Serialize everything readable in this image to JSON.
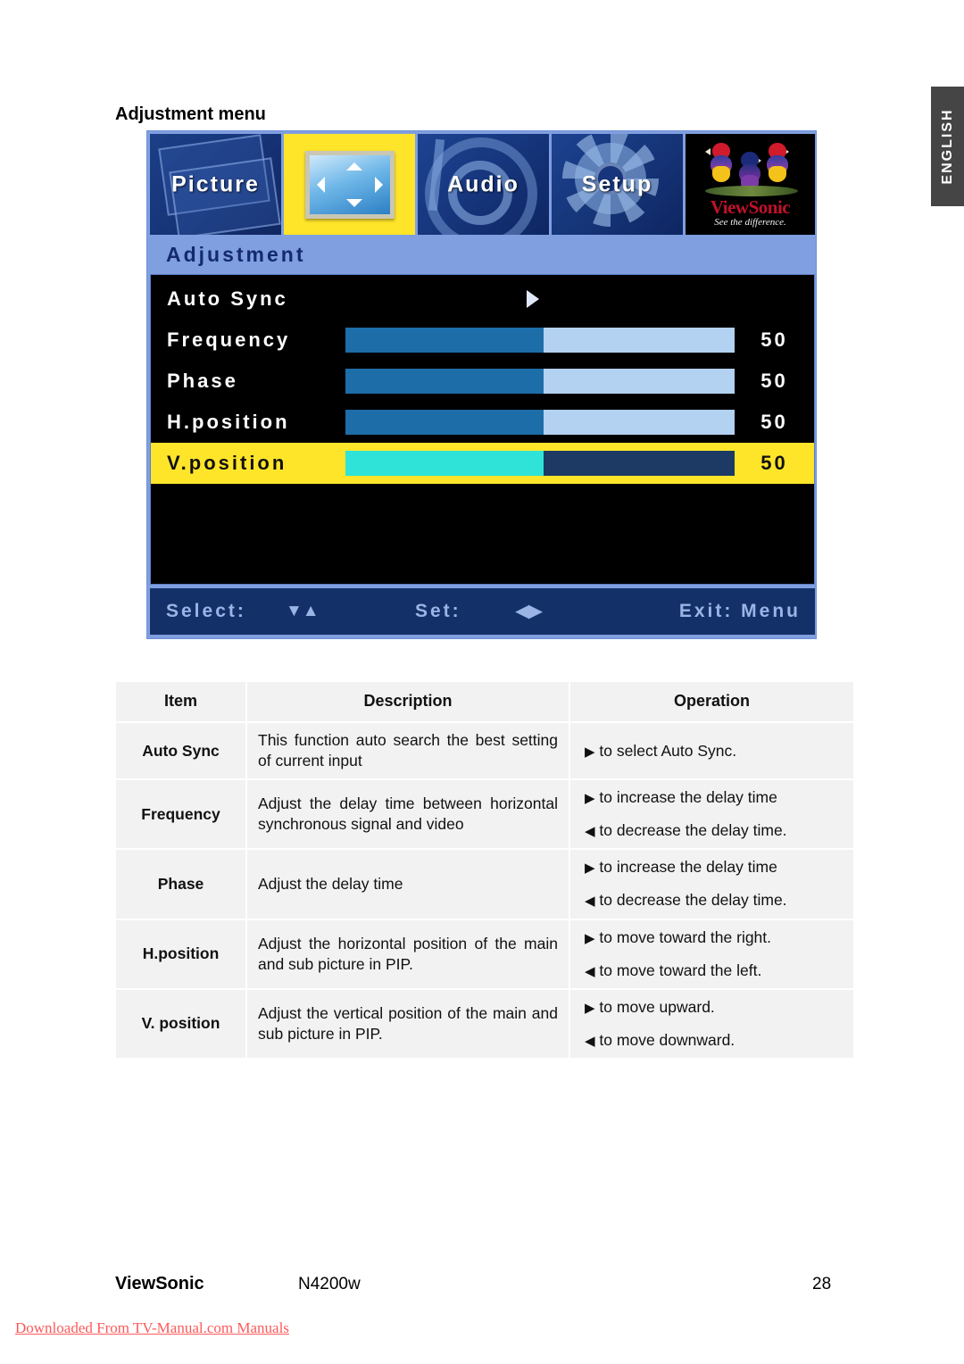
{
  "side_tab": {
    "label": "ENGLISH"
  },
  "page_heading": "Adjustment menu",
  "osd": {
    "tabs": [
      {
        "name": "picture",
        "label": "Picture",
        "selected": false
      },
      {
        "name": "adjustment",
        "label": "",
        "selected": true,
        "icon": "dpad-icon"
      },
      {
        "name": "audio",
        "label": "Audio",
        "selected": false
      },
      {
        "name": "setup",
        "label": "Setup",
        "selected": false
      },
      {
        "name": "viewsonic-logo",
        "label": "",
        "selected": false,
        "brand": "ViewSonic",
        "tagline": "See the difference."
      }
    ],
    "title": "Adjustment",
    "rows": [
      {
        "label": "Auto Sync",
        "type": "arrow",
        "value": "",
        "selected": false
      },
      {
        "label": "Frequency",
        "type": "slider",
        "value": "50",
        "percent": 51,
        "selected": false
      },
      {
        "label": "Phase",
        "type": "slider",
        "value": "50",
        "percent": 51,
        "selected": false
      },
      {
        "label": "H.position",
        "type": "slider",
        "value": "50",
        "percent": 51,
        "selected": false
      },
      {
        "label": "V.position",
        "type": "slider",
        "value": "50",
        "percent": 51,
        "selected": true
      }
    ],
    "footer": {
      "select_label": "Select:",
      "select_glyphs": "▼▲",
      "set_label": "Set:",
      "set_glyphs": "◀▶",
      "exit_label": "Exit: Menu"
    },
    "colors": {
      "frame": "#7f9fe0",
      "body": "#000000",
      "highlight": "#ffe529",
      "slider_fill": "#1d6da8",
      "slider_track": "#b3d1f0",
      "slider_fill_selected": "#2fe3d8",
      "slider_track_selected": "#1c3a63",
      "footer_bar": "#133168",
      "footer_text": "#9ab4e6",
      "title_text": "#142a6e"
    }
  },
  "table": {
    "headers": [
      "Item",
      "Description",
      "Operation"
    ],
    "rows": [
      {
        "item": "Auto Sync",
        "description": "This function auto search the best setting of current input",
        "operations": [
          {
            "glyph": "▶",
            "text": "to select Auto Sync."
          }
        ]
      },
      {
        "item": "Frequency",
        "description": "Adjust the delay time between horizontal synchronous signal and video",
        "operations": [
          {
            "glyph": "▶",
            "text": "to increase the delay time"
          },
          {
            "glyph": "◀",
            "text": "to decrease the delay time."
          }
        ]
      },
      {
        "item": "Phase",
        "description": "Adjust the delay time",
        "operations": [
          {
            "glyph": "▶",
            "text": "to increase the delay time"
          },
          {
            "glyph": "◀",
            "text": "to decrease the delay time."
          }
        ]
      },
      {
        "item": "H.position",
        "description": "Adjust the horizontal position of the main and sub picture in PIP.",
        "operations": [
          {
            "glyph": "▶",
            "text": "to move toward the right."
          },
          {
            "glyph": "◀",
            "text": "to move toward the left."
          }
        ]
      },
      {
        "item": "V. position",
        "description": "Adjust the vertical position of the main and sub picture in PIP.",
        "operations": [
          {
            "glyph": "▶",
            "text": "to move upward."
          },
          {
            "glyph": "◀",
            "text": "to move downward."
          }
        ]
      }
    ]
  },
  "footer": {
    "brand": "ViewSonic",
    "model": "N4200w",
    "page_number": "28",
    "watermark": "Downloaded From TV-Manual.com Manuals"
  }
}
